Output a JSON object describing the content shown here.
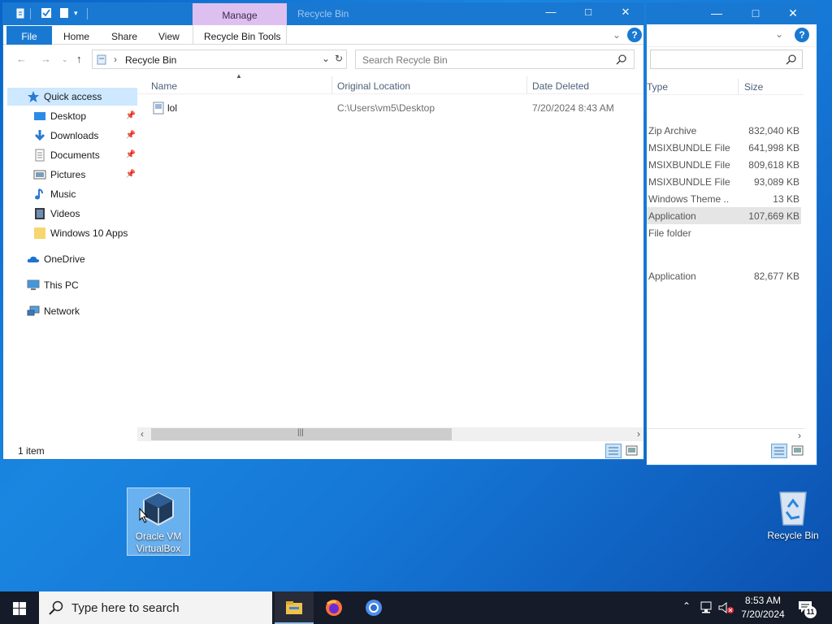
{
  "main_window": {
    "manage_tab": "Manage",
    "title": "Recycle Bin",
    "ribbon_tabs": [
      "File",
      "Home",
      "Share",
      "View",
      "Recycle Bin Tools"
    ],
    "address": "Recycle Bin",
    "search_placeholder": "Search Recycle Bin",
    "columns": [
      "Name",
      "Original Location",
      "Date Deleted"
    ],
    "files": [
      {
        "name": "lol",
        "original_location": "C:\\Users\\vm5\\Desktop",
        "date_deleted": "7/20/2024 8:43 AM"
      }
    ],
    "status": "1 item",
    "nav": {
      "quick_access": "Quick access",
      "items": [
        "Desktop",
        "Downloads",
        "Documents",
        "Pictures",
        "Music",
        "Videos",
        "Windows 10 Apps"
      ],
      "onedrive": "OneDrive",
      "this_pc": "This PC",
      "network": "Network"
    }
  },
  "bg_window": {
    "columns": [
      "Type",
      "Size"
    ],
    "rows": [
      {
        "type": "Zip Archive",
        "size": "832,040 KB"
      },
      {
        "type": "MSIXBUNDLE File",
        "size": "641,998 KB"
      },
      {
        "type": "MSIXBUNDLE File",
        "size": "809,618 KB"
      },
      {
        "type": "MSIXBUNDLE File",
        "size": "93,089 KB"
      },
      {
        "type": "Windows Theme ...",
        "size": "13 KB"
      },
      {
        "type": "Application",
        "size": "107,669 KB"
      },
      {
        "type": "File folder",
        "size": ""
      },
      {
        "type": "Application",
        "size": "82,677 KB"
      }
    ]
  },
  "desktop": {
    "vbox_label_1": "Oracle VM",
    "vbox_label_2": "VirtualBox",
    "recycle_label": "Recycle Bin"
  },
  "taskbar": {
    "search_placeholder": "Type here to search",
    "time": "8:53 AM",
    "date": "7/20/2024",
    "notification_count": "11"
  },
  "colors": {
    "accent": "#1979d2",
    "manage_tab": "#dec0f0",
    "selection": "#cde8ff"
  }
}
